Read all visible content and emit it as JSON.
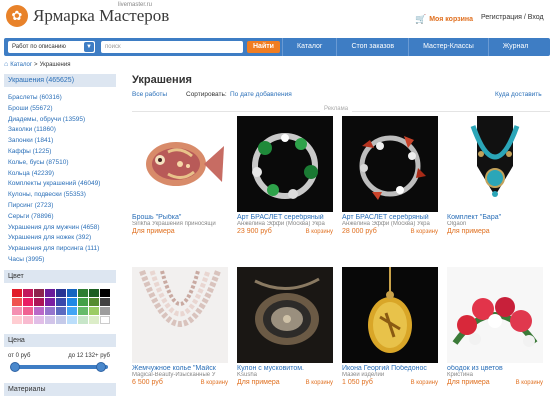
{
  "header": {
    "logo_mark": "✿",
    "logo_text": "Ярмарка Мастеров",
    "logo_sub": "livemaster.ru",
    "cart_label": "Моя корзина",
    "register_label": "Регистрация / Вход"
  },
  "nav": {
    "sort_select": "Работ по описанию",
    "search_placeholder": "поиск",
    "find_button": "Найти",
    "items": [
      "Каталог",
      "Стоп заказов",
      "Мастер-Классы",
      "Журнал"
    ]
  },
  "breadcrumb": {
    "catalog": "Каталог",
    "sep": ">",
    "current": "Украшения"
  },
  "sidebar": {
    "heading": "Украшения (465625)",
    "categories": [
      "Браслеты (60316)",
      "Броши (55672)",
      "Диадемы, обручи (13595)",
      "Заколки (11860)",
      "Запонки (1841)",
      "Каффы (1225)",
      "Колье, бусы (87510)",
      "Кольца (42239)",
      "Комплекты украшений (46049)",
      "Кулоны, подвески (55353)",
      "Пирсинг (2723)",
      "Серьги (78896)",
      "Украшения для мужчин (4658)",
      "Украшения для ножек (392)",
      "Украшения для пирсинга (111)",
      "Часы (3995)"
    ],
    "color_heading": "Цвет",
    "colors": [
      "#e11d2a",
      "#c2185b",
      "#8e244d",
      "#6a1b9a",
      "#283593",
      "#1565c0",
      "#2e7d32",
      "#1b5e20",
      "#000000",
      "#ef5350",
      "#e91e63",
      "#ad1457",
      "#7b1fa2",
      "#3949ab",
      "#1e88e5",
      "#43a047",
      "#558b2f",
      "#424242",
      "#f48fb1",
      "#f06292",
      "#ba68c8",
      "#9575cd",
      "#5c6bc0",
      "#42a5f5",
      "#66bb6a",
      "#9ccc65",
      "#9e9e9e",
      "#ffcdd2",
      "#f8bbd0",
      "#e1bee7",
      "#d1c4e9",
      "#c5cae9",
      "#bbdefb",
      "#c8e6c9",
      "#dcedc8",
      "#ffffff"
    ],
    "price_heading": "Цена",
    "price_from": "от  0 руб",
    "price_to": "до  12 132+ руб",
    "price_min_fraction": 0.0,
    "price_max_fraction": 1.0,
    "materials_heading": "Материалы"
  },
  "main": {
    "title": "Украшения",
    "all_works": "Все работы",
    "sort_label": "Сортировать:",
    "sort_value": "По дате добавления",
    "where_buy": "Куда доставить",
    "ad_label": "Реклама",
    "example_label": "Для примера",
    "cart_label": "В корзину",
    "products": [
      {
        "title": "Брошь \"Рыбка\"",
        "seller": "Sirikha Украшения приносящи",
        "price": "Для примера",
        "cart": "",
        "art": "fish"
      },
      {
        "title": "Арт БРАСЛЕТ серебряный",
        "seller": "Анжелина Эффи (Москва) Укра",
        "price": "23 900 руб",
        "cart": "В корзину",
        "art": "bracelet1"
      },
      {
        "title": "Арт БРАСЛЕТ серебряный",
        "seller": "Анжелина Эффи (Москва) Укра",
        "price": "28 000 руб",
        "cart": "В корзину",
        "art": "bracelet2"
      },
      {
        "title": "Комплект \"Бара\"",
        "seller": "Olgaon",
        "price": "Для примера",
        "cart": "",
        "art": "necklace"
      },
      {
        "title": "Жемчужное колье \"Майск",
        "seller": "Magical-Beauty-Изысканные У",
        "price": "6 500 руб",
        "cart": "В корзину",
        "art": "pearls"
      },
      {
        "title": "Кулон с мусковитом.",
        "seller": "Ksusha",
        "price": "Для примера",
        "cart": "В корзину",
        "art": "pendant"
      },
      {
        "title": "Икона Георгий Победонос",
        "seller": "Мазей изделии",
        "price": "1 050 руб",
        "cart": "В корзину",
        "art": "icon"
      },
      {
        "title": "ободок из цветов",
        "seller": "Кристина",
        "price": "Для примера",
        "cart": "В корзину",
        "art": "flowers"
      }
    ]
  }
}
